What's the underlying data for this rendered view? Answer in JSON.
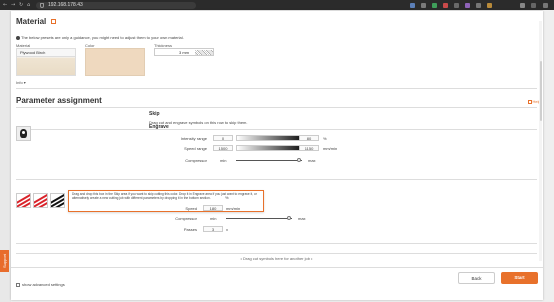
{
  "browser": {
    "url": "192.168.178.43"
  },
  "feedback_tab": {
    "label": "Support"
  },
  "material_section": {
    "title": "Material",
    "note": "The below presets are only a guidance, you might need to adjust them to your own material.",
    "material_label": "Material",
    "material_value": "Plywood Birch",
    "color_label": "Color",
    "thickness_label": "Thickness",
    "thickness_value": "3 mm",
    "info_link": "Info ▾"
  },
  "parameter_section": {
    "title": "Parameter assignment",
    "help_label": "Help",
    "skip": {
      "title": "Skip",
      "text": "Drag cut and engrave symbols on this row to skip them."
    },
    "engrave": {
      "title": "Engrave",
      "intensity_label": "Intensity range",
      "intensity_min": "0",
      "intensity_max": "80",
      "intensity_unit": "%",
      "speed_label": "Speed range",
      "speed_min": "1500",
      "speed_max": "1150",
      "speed_unit": "mm/min",
      "compressor_label": "Compressor",
      "compressor_min": "min",
      "compressor_max": "max",
      "compressor_level": 0.95
    },
    "cut": {
      "tooltip": "Drag and drop this box in the Skip area if you want to skip cutting this color. Drop it in Engrave area if you just want to engrave it, or alternatively create a new cutting job with different parameters by dropping it in the bottom section.",
      "intensity_unit": "%",
      "speed_label": "Speed",
      "speed_value": "180",
      "speed_unit": "mm/min",
      "compressor_label": "Compressor",
      "compressor_min": "min",
      "compressor_max": "max",
      "compressor_level": 0.95,
      "passes_label": "Passes",
      "passes_value": "3",
      "passes_unit": "x",
      "swatch_colors": [
        "#d9232a",
        "#d9232a",
        "#111111"
      ]
    },
    "dropzone_text": "• Drag cut symbols here for another job •"
  },
  "footer": {
    "advanced_label": "show advanced settings",
    "back_label": "Back",
    "start_label": "Start"
  },
  "colors": {
    "accent": "#e8712b",
    "cut_red": "#d9232a"
  }
}
